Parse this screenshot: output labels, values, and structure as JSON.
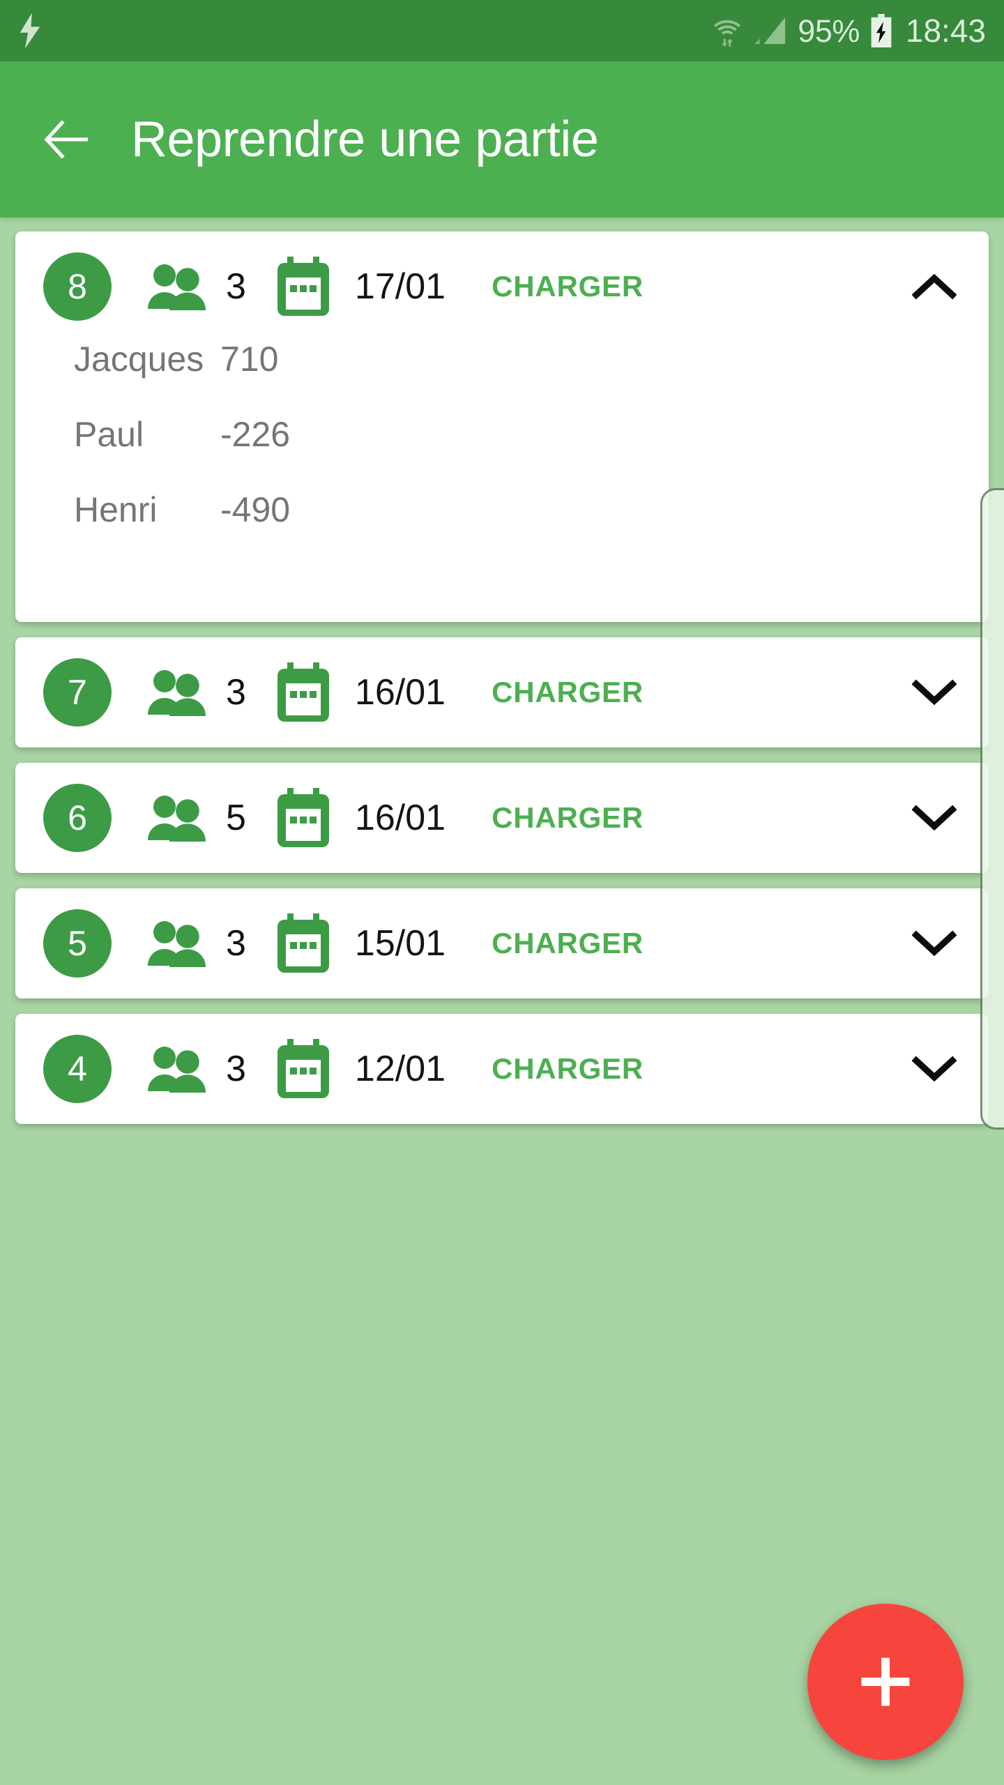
{
  "status_bar": {
    "left_icon": "flash-icon",
    "wifi_icon": "wifi-transfer-icon",
    "signal_icon": "cellular-signal-icon",
    "battery_percent": "95%",
    "battery_icon": "battery-charging-icon",
    "time": "18:43",
    "background_color": "#37893b"
  },
  "app_bar": {
    "back_icon": "arrow-left-icon",
    "title": "Reprendre une partie",
    "background_color": "#4caf50",
    "title_color": "#ffffff"
  },
  "theme": {
    "page_background": "#a8d5a3",
    "accent_green": "#4caf50",
    "badge_green": "#3d9b46",
    "fab_red": "#f6453c",
    "score_text": "#757575"
  },
  "list": {
    "action_label": "CHARGER",
    "games": [
      {
        "number": "8",
        "players_count": "3",
        "date": "17/01",
        "action": "CHARGER",
        "expanded": true,
        "chevron": "chevron-up-icon",
        "scores": [
          {
            "name": "Jacques",
            "value": "710"
          },
          {
            "name": "Paul",
            "value": "-226"
          },
          {
            "name": "Henri",
            "value": "-490"
          }
        ]
      },
      {
        "number": "7",
        "players_count": "3",
        "date": "16/01",
        "action": "CHARGER",
        "expanded": false,
        "chevron": "chevron-down-icon",
        "scores": []
      },
      {
        "number": "6",
        "players_count": "5",
        "date": "16/01",
        "action": "CHARGER",
        "expanded": false,
        "chevron": "chevron-down-icon",
        "scores": []
      },
      {
        "number": "5",
        "players_count": "3",
        "date": "15/01",
        "action": "CHARGER",
        "expanded": false,
        "chevron": "chevron-down-icon",
        "scores": []
      },
      {
        "number": "4",
        "players_count": "3",
        "date": "12/01",
        "action": "CHARGER",
        "expanded": false,
        "chevron": "chevron-down-icon",
        "scores": []
      }
    ]
  },
  "fab": {
    "icon": "plus-icon",
    "label": "+"
  },
  "scrollbar": {
    "icon": "vertical-scrollbar-thumb"
  }
}
